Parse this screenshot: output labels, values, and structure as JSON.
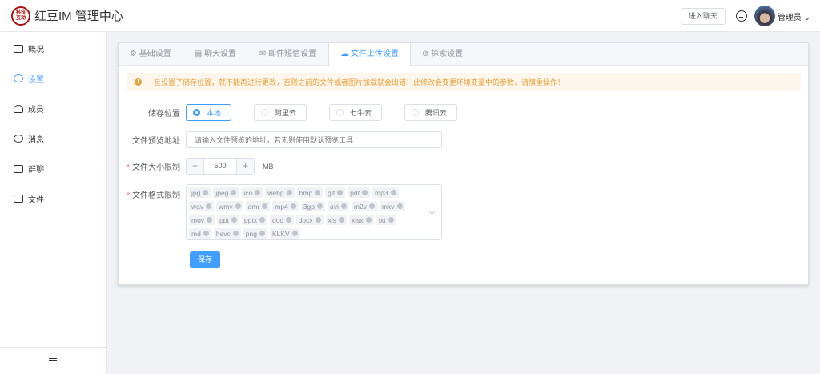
{
  "header": {
    "logo_text": "科技互动",
    "title": "红豆IM 管理中心",
    "enter_chat": "进入聊天",
    "user_name": "管理员"
  },
  "sidebar": {
    "items": [
      {
        "label": "概况"
      },
      {
        "label": "设置"
      },
      {
        "label": "成员"
      },
      {
        "label": "消息"
      },
      {
        "label": "群聊"
      },
      {
        "label": "文件"
      }
    ],
    "active": "设置"
  },
  "tabs": [
    {
      "label": "基础设置"
    },
    {
      "label": "聊天设置"
    },
    {
      "label": "邮件短信设置"
    },
    {
      "label": "文件上传设置"
    },
    {
      "label": "探索设置"
    }
  ],
  "alert": "一旦设置了储存位置，就不能再进行更改，否则之前的文件或者图片加载就会出错！此修改会变更环境变量中的参数，请慎重操作！",
  "form": {
    "storage_label": "储存位置",
    "storage_options": [
      "本地",
      "阿里云",
      "七牛云",
      "腾讯云"
    ],
    "storage_selected": "本地",
    "preview_label": "文件预览地址",
    "preview_placeholder": "请输入文件预览的地址，若无则使用默认预览工具",
    "size_label": "文件大小限制",
    "size_value": "500",
    "size_unit": "MB",
    "minus": "−",
    "plus": "+",
    "format_label": "文件格式限制",
    "formats": [
      "jpg",
      "jpeg",
      "ico",
      "webp",
      "bmp",
      "gif",
      "pdf",
      "mp3",
      "wav",
      "wmv",
      "amr",
      "mp4",
      "3gp",
      "avi",
      "m2v",
      "mkv",
      "mov",
      "ppt",
      "pptx",
      "doc",
      "docx",
      "xls",
      "xlsx",
      "txt",
      "md",
      "hevc",
      "png",
      "KLKV"
    ],
    "save": "保存"
  }
}
